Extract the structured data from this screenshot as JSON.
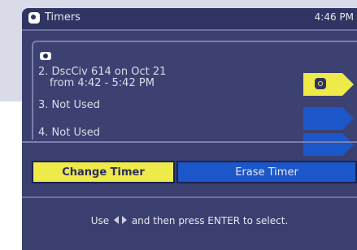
{
  "window": {
    "title": "Timers",
    "time": "4:46 PM"
  },
  "timers": [
    {
      "line1": "2. DscCiv 614 on Oct 21",
      "line2": "from 4:42 - 5:42 PM",
      "status": "scheduled"
    },
    {
      "line1": "3. Not Used",
      "line2": "",
      "status": "empty"
    },
    {
      "line1": "4. Not Used",
      "line2": "",
      "status": "empty"
    }
  ],
  "buttons": {
    "change": "Change Timer",
    "erase": "Erase Timer"
  },
  "help": {
    "before": "Use",
    "after": "and then press ENTER to select."
  },
  "colors": {
    "highlight": "#eeea4a",
    "accent": "#1b57c9",
    "screen": "#3a3f6f"
  },
  "icons": [
    "timer-icon",
    "timer-icon",
    "clock-icon",
    "left-right-arrows-icon"
  ]
}
